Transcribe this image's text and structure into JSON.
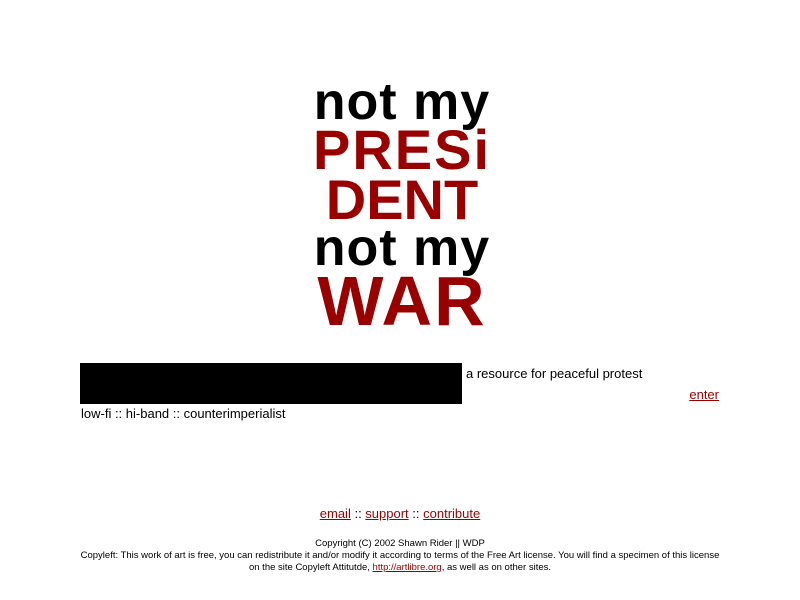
{
  "logo": {
    "line1": "not my",
    "line2": "PRESi",
    "line3": "DENT",
    "line4": "not my",
    "line5": "WAR"
  },
  "tagline": "a resource for peaceful protest",
  "enter_link": "enter",
  "subtagline": "low-fi :: hi-band :: counterimperialist",
  "nav": {
    "email": "email",
    "sep1": " :: ",
    "support": "support",
    "sep2": " :: ",
    "contribute": "contribute"
  },
  "footer": {
    "copyright": "Copyright (C) 2002 Shawn Rider || WDP",
    "copyleft_before": "Copyleft: This work of art is free, you can redistribute it and/or modify it according to terms of the Free Art license. You will find a specimen of this license on the site Copyleft Attitutde, ",
    "link": "http://artlibre.org",
    "copyleft_after": ", as well as on other sites."
  },
  "colors": {
    "accent_red": "#990000",
    "text": "#000000",
    "background": "#ffffff"
  }
}
